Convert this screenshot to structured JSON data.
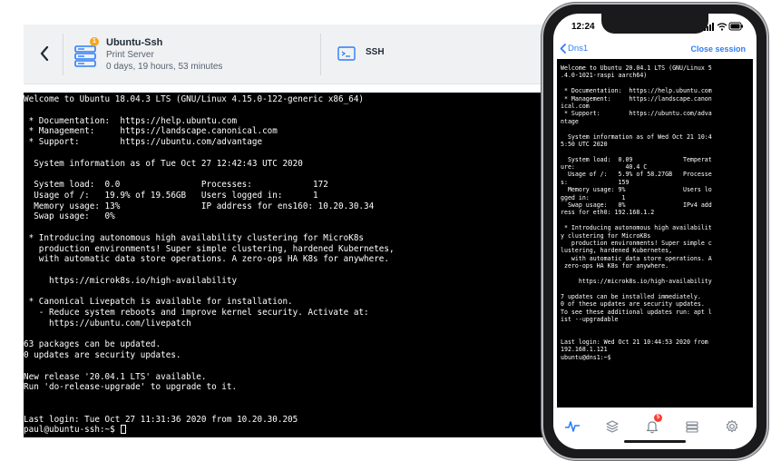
{
  "header": {
    "server_name": "Ubuntu-Ssh",
    "server_role": "Print Server",
    "uptime": "0 days, 19 hours, 53 minutes",
    "alert_count": "1",
    "session_type": "SSH",
    "icons": {
      "back": "chevron-left-icon",
      "server": "server-stack-icon",
      "ssh": "terminal-icon"
    }
  },
  "desktop_terminal": {
    "lines": [
      "Welcome to Ubuntu 18.04.3 LTS (GNU/Linux 4.15.0-122-generic x86_64)",
      "",
      " * Documentation:  https://help.ubuntu.com",
      " * Management:     https://landscape.canonical.com",
      " * Support:        https://ubuntu.com/advantage",
      "",
      "  System information as of Tue Oct 27 12:42:43 UTC 2020",
      "",
      "  System load:  0.0                Processes:            172",
      "  Usage of /:   19.9% of 19.56GB   Users logged in:      1",
      "  Memory usage: 13%                IP address for ens160: 10.20.30.34",
      "  Swap usage:   0%",
      "",
      " * Introducing autonomous high availability clustering for MicroK8s",
      "   production environments! Super simple clustering, hardened Kubernetes,",
      "   with automatic data store operations. A zero-ops HA K8s for anywhere.",
      "",
      "     https://microk8s.io/high-availability",
      "",
      " * Canonical Livepatch is available for installation.",
      "   - Reduce system reboots and improve kernel security. Activate at:",
      "     https://ubuntu.com/livepatch",
      "",
      "63 packages can be updated.",
      "0 updates are security updates.",
      "",
      "New release '20.04.1 LTS' available.",
      "Run 'do-release-upgrade' to upgrade to it.",
      "",
      "",
      "Last login: Tue Oct 27 11:31:36 2020 from 10.20.30.205"
    ],
    "prompt": "paul@ubuntu-ssh:~$ "
  },
  "phone": {
    "status_time": "12:24",
    "nav_back_label": "Dns1",
    "nav_action": "Close session",
    "tab_badge": "5",
    "tabs": [
      "activity-icon",
      "layers-icon",
      "bell-icon",
      "list-icon",
      "gear-icon"
    ],
    "terminal_lines": [
      "Welcome to Ubuntu 20.04.1 LTS (GNU/Linux 5",
      ".4.0-1021-raspi aarch64)",
      "",
      " * Documentation:  https://help.ubuntu.com",
      " * Management:     https://landscape.canon",
      "ical.com",
      " * Support:        https://ubuntu.com/adva",
      "ntage",
      "",
      "  System information as of Wed Oct 21 10:4",
      "5:50 UTC 2020",
      "",
      "  System load:  0.09              Temperat",
      "ure:              40.4 C",
      "  Usage of /:   5.9% of 58.27GB   Processe",
      "s:              159",
      "  Memory usage: 9%                Users lo",
      "gged in:         1",
      "  Swap usage:   0%                IPv4 add",
      "ress for eth0: 192.168.1.2",
      "",
      " * Introducing autonomous high availabilit",
      "y clustering for MicroK8s",
      "   production environments! Super simple c",
      "lustering, hardened Kubernetes,",
      "   with automatic data store operations. A",
      " zero-ops HA K8s for anywhere.",
      "",
      "     https://microk8s.io/high-availability",
      "",
      "7 updates can be installed immediately.",
      "0 of these updates are security updates.",
      "To see these additional updates run: apt l",
      "ist --upgradable",
      "",
      "",
      "Last login: Wed Oct 21 10:44:53 2020 from",
      "192.168.1.121",
      "ubuntu@dns1:~$"
    ]
  },
  "colors": {
    "accent": "#2d7ef7",
    "terminal_bg": "#000000",
    "terminal_fg": "#ffffff",
    "header_bg": "#f0f1f3",
    "badge_orange": "#f5a623",
    "badge_red": "#ff3b30"
  }
}
